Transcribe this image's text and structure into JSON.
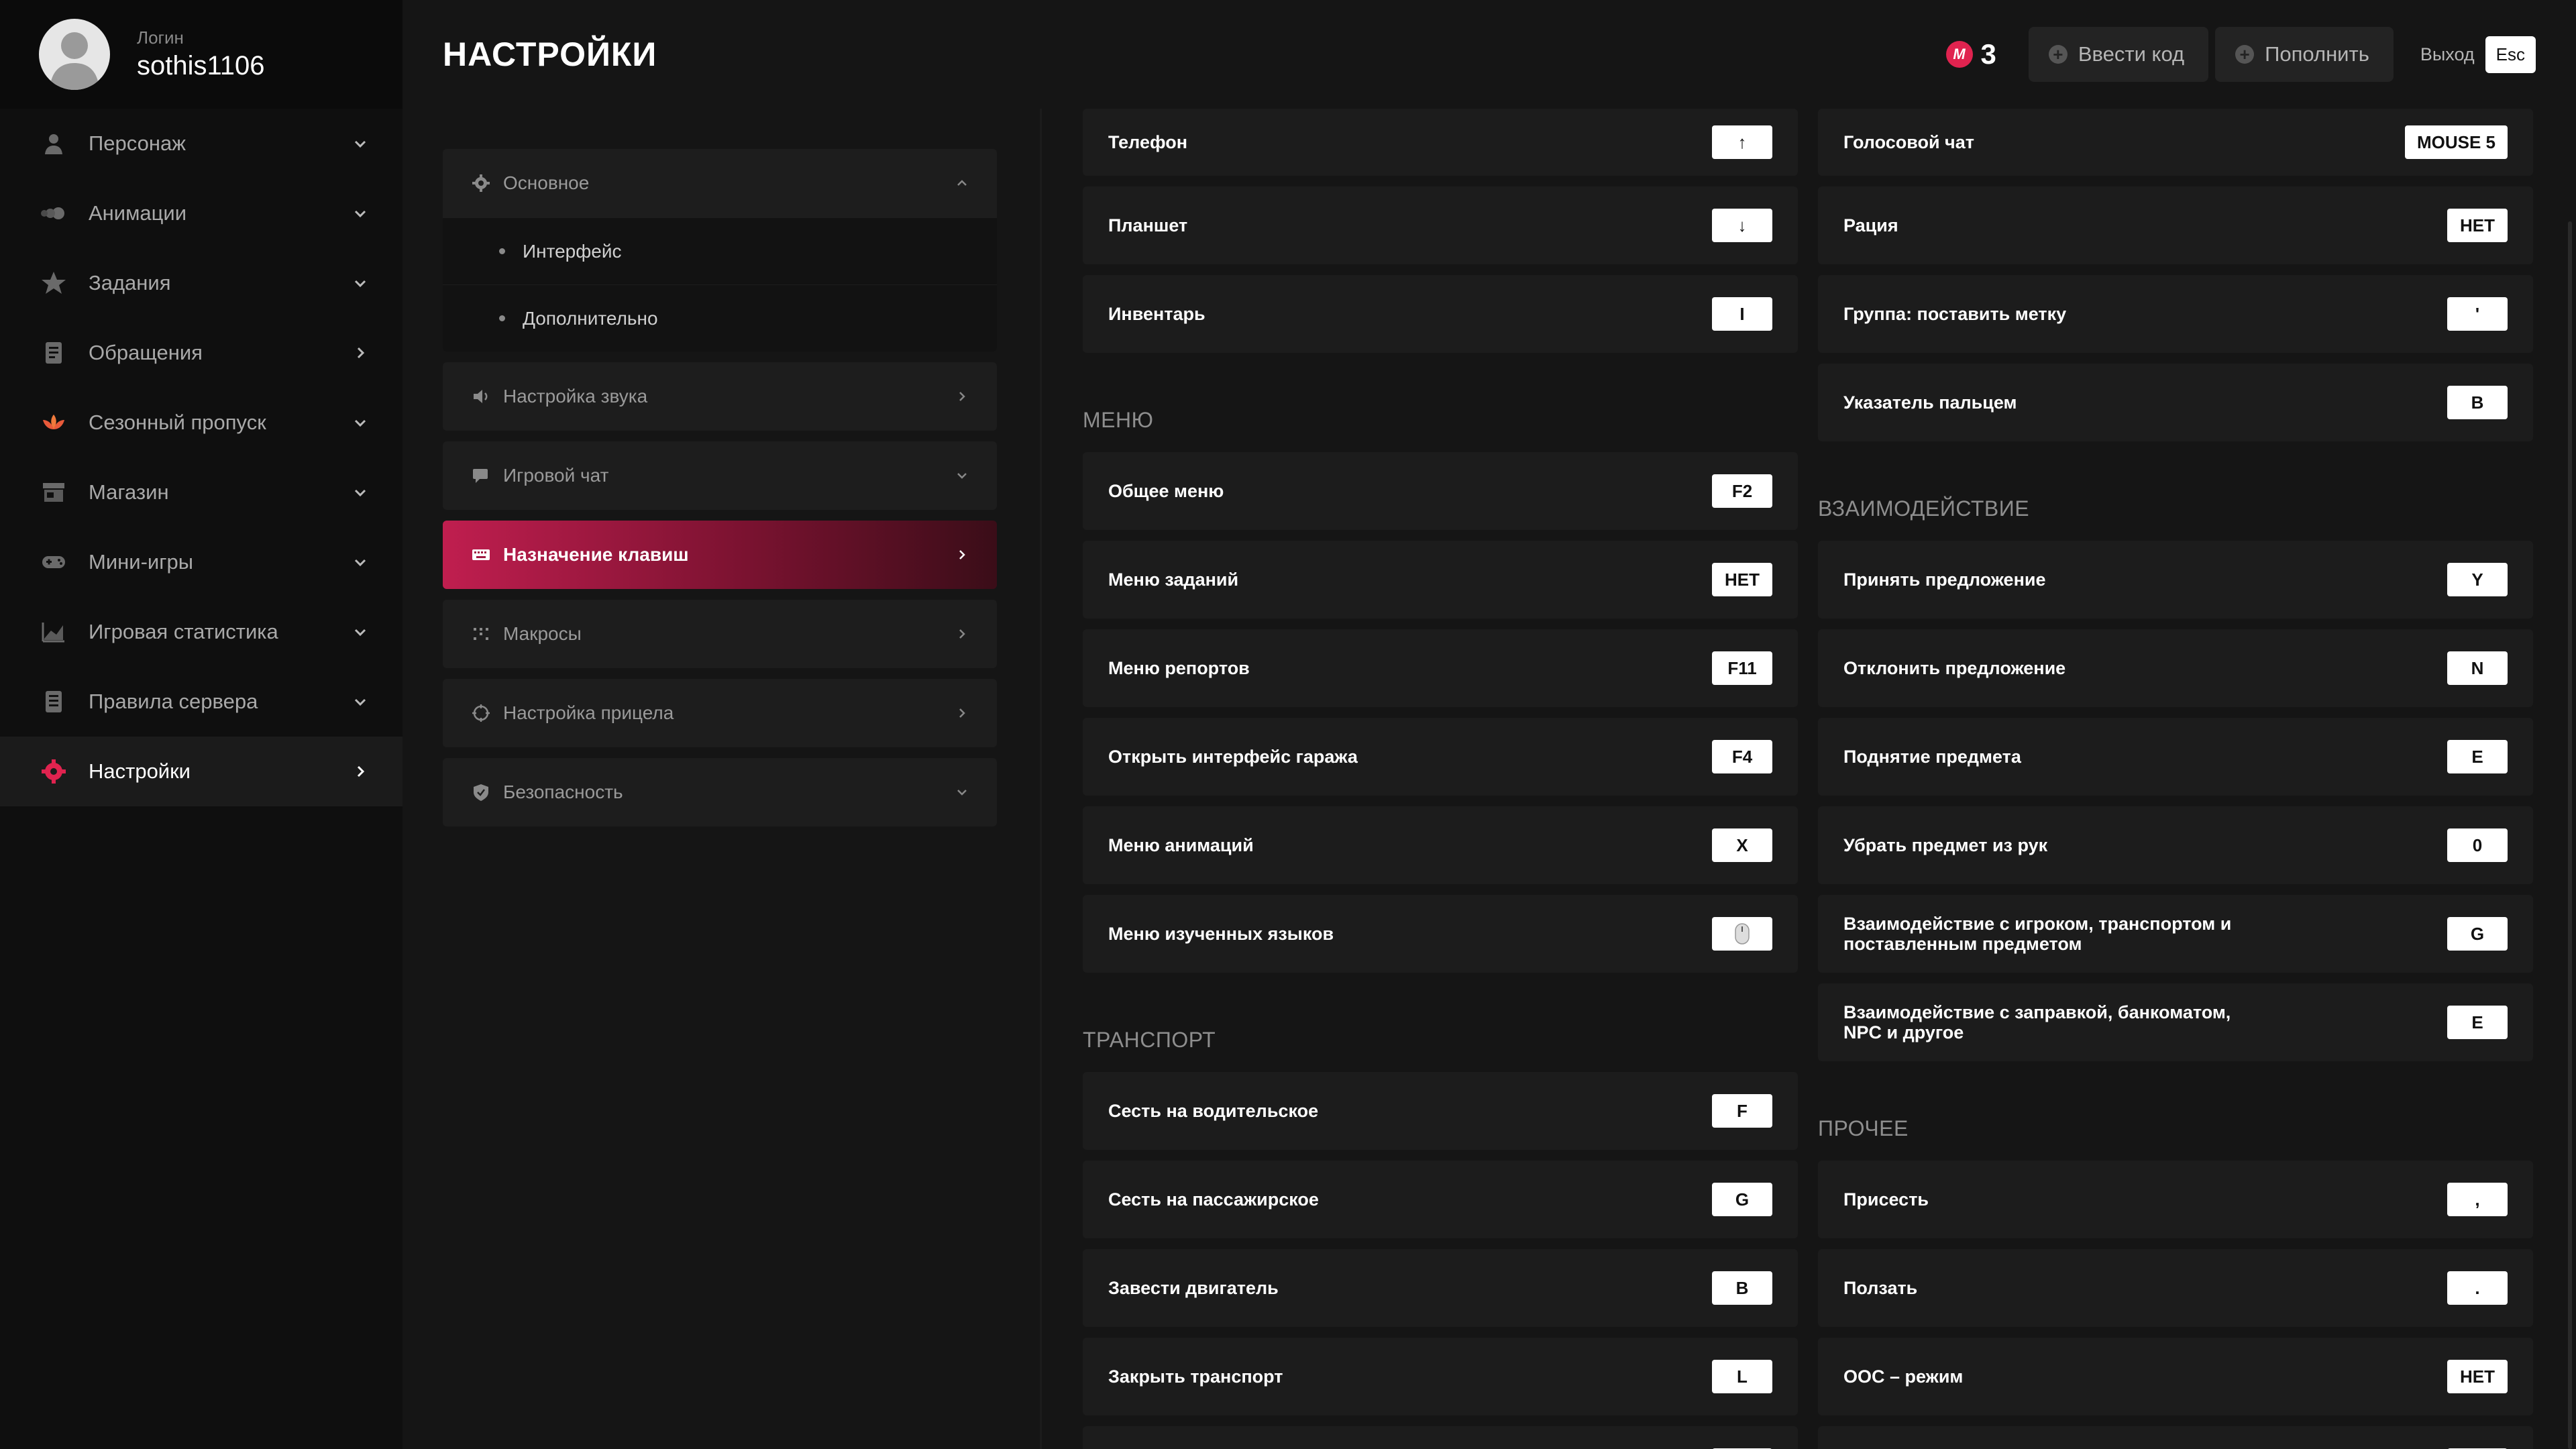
{
  "user": {
    "label": "Логин",
    "name": "sothis1106"
  },
  "sidebar": {
    "items": [
      {
        "label": "Персонаж",
        "icon": "person-icon",
        "chevron": "down"
      },
      {
        "label": "Анимации",
        "icon": "animation-icon",
        "chevron": "down"
      },
      {
        "label": "Задания",
        "icon": "star-icon",
        "chevron": "down"
      },
      {
        "label": "Обращения",
        "icon": "document-icon",
        "chevron": "right"
      },
      {
        "label": "Сезонный пропуск",
        "icon": "lotus-icon",
        "chevron": "down"
      },
      {
        "label": "Магазин",
        "icon": "store-icon",
        "chevron": "down"
      },
      {
        "label": "Мини-игры",
        "icon": "gamepad-icon",
        "chevron": "down"
      },
      {
        "label": "Игровая статистика",
        "icon": "stats-icon",
        "chevron": "down"
      },
      {
        "label": "Правила сервера",
        "icon": "rules-icon",
        "chevron": "down"
      },
      {
        "label": "Настройки",
        "icon": "gear-icon",
        "chevron": "right",
        "active": true
      }
    ]
  },
  "header": {
    "title": "НАСТРОЙКИ",
    "coins": "3",
    "coin_symbol": "M",
    "enter_code": "Ввести код",
    "top_up": "Пополнить",
    "exit": "Выход",
    "esc": "Esc"
  },
  "categories": {
    "main": {
      "label": "Основное",
      "subs": [
        "Интерфейс",
        "Дополнительно"
      ]
    },
    "items": [
      {
        "label": "Настройка звука"
      },
      {
        "label": "Игровой чат"
      },
      {
        "label": "Назначение клавиш"
      },
      {
        "label": "Макросы"
      },
      {
        "label": "Настройка прицела"
      },
      {
        "label": "Безопасность"
      }
    ]
  },
  "keybinds": {
    "left": {
      "top": [
        {
          "label": "Телефон",
          "key": "↑"
        },
        {
          "label": "Планшет",
          "key": "↓"
        },
        {
          "label": "Инвентарь",
          "key": "I"
        }
      ],
      "menu_title": "МЕНЮ",
      "menu": [
        {
          "label": "Общее меню",
          "key": "F2"
        },
        {
          "label": "Меню заданий",
          "key": "НЕТ"
        },
        {
          "label": "Меню репортов",
          "key": "F11"
        },
        {
          "label": "Открыть интерфейс гаража",
          "key": "F4"
        },
        {
          "label": "Меню анимаций",
          "key": "X"
        },
        {
          "label": "Меню изученных языков",
          "key": ""
        }
      ],
      "transport_title": "ТРАНСПОРТ",
      "transport": [
        {
          "label": "Сесть на водительское",
          "key": "F"
        },
        {
          "label": "Сесть на пассажирское",
          "key": "G"
        },
        {
          "label": "Завести двигатель",
          "key": "B"
        },
        {
          "label": "Закрыть транспорт",
          "key": "L"
        }
      ]
    },
    "right": {
      "top": [
        {
          "label": "Голосовой чат",
          "key": "MOUSE 5"
        },
        {
          "label": "Рация",
          "key": "НЕТ"
        },
        {
          "label": "Группа: поставить метку",
          "key": "'"
        },
        {
          "label": "Указатель пальцем",
          "key": "B"
        }
      ],
      "interaction_title": "ВЗАИМОДЕЙСТВИЕ",
      "interaction": [
        {
          "label": "Принять предложение",
          "key": "Y"
        },
        {
          "label": "Отклонить предложение",
          "key": "N"
        },
        {
          "label": "Поднятие предмета",
          "key": "E"
        },
        {
          "label": "Убрать предмет из рук",
          "key": "0"
        },
        {
          "label": "Взаимодействие с игроком, транспортом и поставленным предметом",
          "key": "G"
        },
        {
          "label": "Взаимодействие с заправкой, банкоматом, NPC и другое",
          "key": "E"
        }
      ],
      "other_title": "ПРОЧЕЕ",
      "other": [
        {
          "label": "Присесть",
          "key": ","
        },
        {
          "label": "Ползать",
          "key": "."
        },
        {
          "label": "OOC – режим",
          "key": "НЕТ"
        }
      ]
    }
  },
  "colors": {
    "accent": "#c01e4f",
    "coin": "#e0234f",
    "background": "#151515"
  }
}
